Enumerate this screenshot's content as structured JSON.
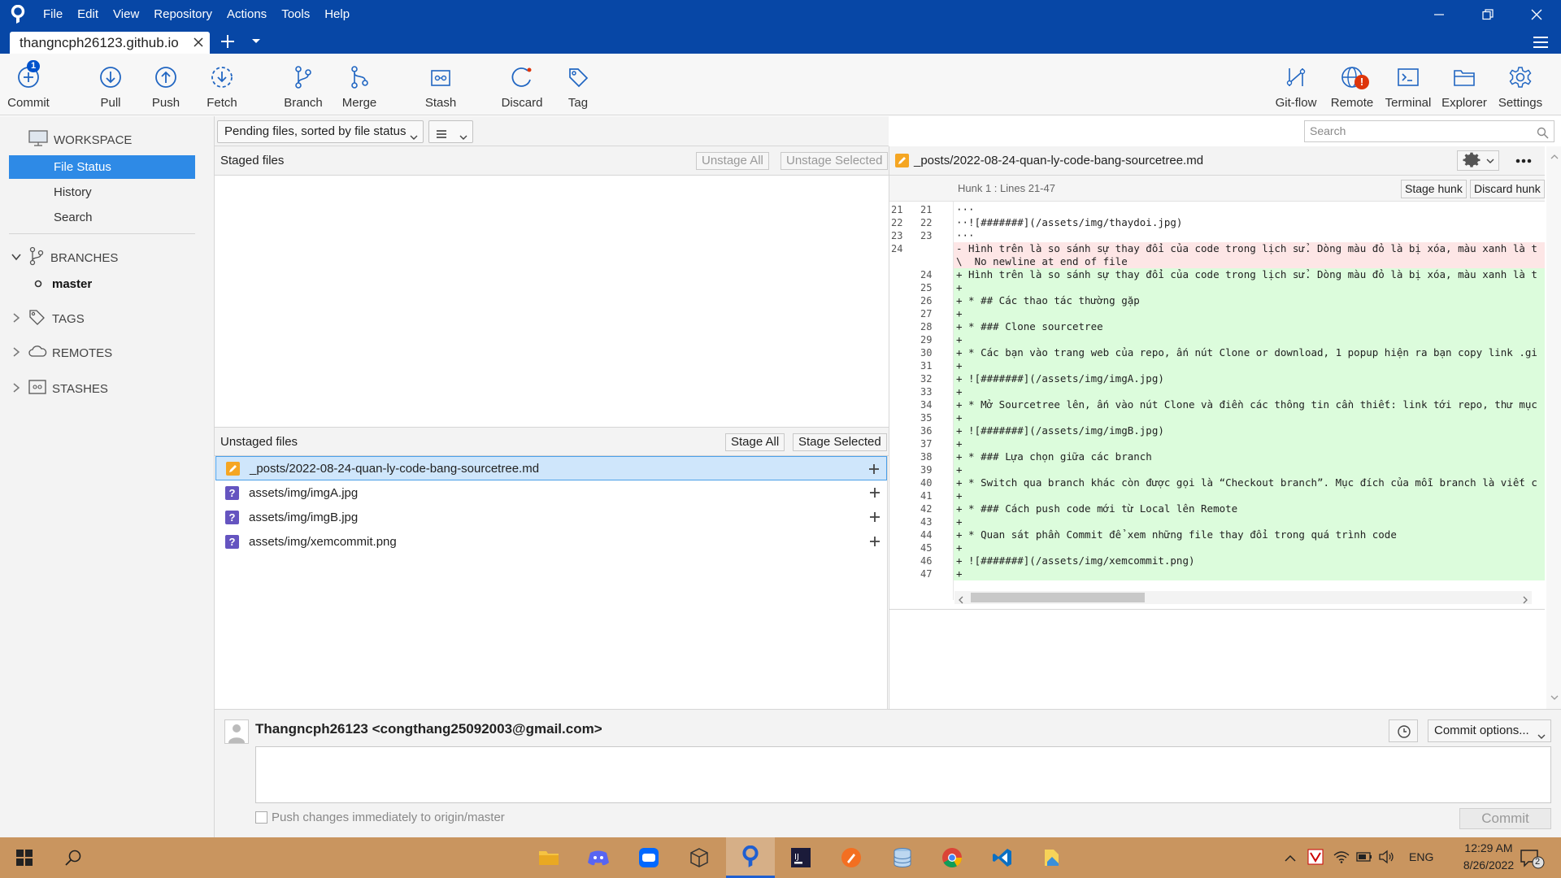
{
  "window": {
    "menu": [
      "File",
      "Edit",
      "View",
      "Repository",
      "Actions",
      "Tools",
      "Help"
    ],
    "repo_tab": "thangncph26123.github.io"
  },
  "toolbar": {
    "left": [
      {
        "label": "Commit",
        "icon": "commit-plus-icon",
        "badge": "1"
      },
      {
        "label": "Pull",
        "icon": "pull-arrow-down-icon"
      },
      {
        "label": "Push",
        "icon": "push-arrow-up-icon"
      },
      {
        "label": "Fetch",
        "icon": "fetch-dashed-arrow-icon"
      },
      {
        "label": "Branch",
        "icon": "branch-icon"
      },
      {
        "label": "Merge",
        "icon": "merge-icon"
      },
      {
        "label": "Stash",
        "icon": "stash-icon"
      },
      {
        "label": "Discard",
        "icon": "discard-icon"
      },
      {
        "label": "Tag",
        "icon": "tag-icon"
      }
    ],
    "right": [
      {
        "label": "Git-flow",
        "icon": "git-flow-icon"
      },
      {
        "label": "Remote",
        "icon": "globe-icon",
        "alert": "!"
      },
      {
        "label": "Terminal",
        "icon": "terminal-icon"
      },
      {
        "label": "Explorer",
        "icon": "folder-icon"
      },
      {
        "label": "Settings",
        "icon": "gear-icon"
      }
    ]
  },
  "sidebar": {
    "workspace": "WORKSPACE",
    "items": [
      "File Status",
      "History",
      "Search"
    ],
    "branches": "BRANCHES",
    "current_branch": "master",
    "tags": "TAGS",
    "remotes": "REMOTES",
    "stashes": "STASHES"
  },
  "filter": {
    "sort_label": "Pending files, sorted by file status",
    "view_icon": "list-view-icon"
  },
  "staged": {
    "title": "Staged files",
    "unstage_all": "Unstage All",
    "unstage_selected": "Unstage Selected"
  },
  "unstaged": {
    "title": "Unstaged files",
    "stage_all": "Stage All",
    "stage_selected": "Stage Selected",
    "files": [
      {
        "name": "_posts/2022-08-24-quan-ly-code-bang-sourcetree.md",
        "status": "modified"
      },
      {
        "name": "assets/img/imgA.jpg",
        "status": "untracked"
      },
      {
        "name": "assets/img/imgB.jpg",
        "status": "untracked"
      },
      {
        "name": "assets/img/xemcommit.png",
        "status": "untracked"
      }
    ]
  },
  "search": {
    "placeholder": "Search"
  },
  "diff": {
    "file": "_posts/2022-08-24-quan-ly-code-bang-sourcetree.md",
    "hunk": "Hunk 1 : Lines 21-47",
    "stage_hunk": "Stage hunk",
    "discard_hunk": "Discard hunk",
    "lines": [
      {
        "old": "21",
        "new": "21",
        "type": "ctx",
        "text": "···"
      },
      {
        "old": "22",
        "new": "22",
        "type": "ctx",
        "text": "··![#######](/assets/img/thaydoi.jpg)"
      },
      {
        "old": "23",
        "new": "23",
        "type": "ctx",
        "text": "···"
      },
      {
        "old": "24",
        "new": "",
        "type": "del",
        "text": "- Hình trên là so sánh sự thay đổi của code trong lịch sử. Dòng màu đỏ là bị xóa, màu xanh là t"
      },
      {
        "old": "",
        "new": "",
        "type": "del",
        "text": "\\  No newline at end of file"
      },
      {
        "old": "",
        "new": "24",
        "type": "add",
        "text": "+ Hình trên là so sánh sự thay đổi của code trong lịch sử. Dòng màu đỏ là bị xóa, màu xanh là t"
      },
      {
        "old": "",
        "new": "25",
        "type": "add",
        "text": "+"
      },
      {
        "old": "",
        "new": "26",
        "type": "add",
        "text": "+ * ## Các thao tác thường gặp"
      },
      {
        "old": "",
        "new": "27",
        "type": "add",
        "text": "+"
      },
      {
        "old": "",
        "new": "28",
        "type": "add",
        "text": "+ * ### Clone sourcetree"
      },
      {
        "old": "",
        "new": "29",
        "type": "add",
        "text": "+"
      },
      {
        "old": "",
        "new": "30",
        "type": "add",
        "text": "+ * Các bạn vào trang web của repo, ấn nút Clone or download, 1 popup hiện ra bạn copy link .gi"
      },
      {
        "old": "",
        "new": "31",
        "type": "add",
        "text": "+"
      },
      {
        "old": "",
        "new": "32",
        "type": "add",
        "text": "+ ![#######](/assets/img/imgA.jpg)"
      },
      {
        "old": "",
        "new": "33",
        "type": "add",
        "text": "+"
      },
      {
        "old": "",
        "new": "34",
        "type": "add",
        "text": "+ * Mở Sourcetree lên, ấn vào nút Clone và điền các thông tin cần thiết: link tới repo, thư mục"
      },
      {
        "old": "",
        "new": "35",
        "type": "add",
        "text": "+"
      },
      {
        "old": "",
        "new": "36",
        "type": "add",
        "text": "+ ![#######](/assets/img/imgB.jpg)"
      },
      {
        "old": "",
        "new": "37",
        "type": "add",
        "text": "+"
      },
      {
        "old": "",
        "new": "38",
        "type": "add",
        "text": "+ * ### Lựa chọn giữa các branch"
      },
      {
        "old": "",
        "new": "39",
        "type": "add",
        "text": "+"
      },
      {
        "old": "",
        "new": "40",
        "type": "add",
        "text": "+ * Switch qua branch khác còn được gọi là “Checkout branch”. Mục đích của mỗi branch là viết c"
      },
      {
        "old": "",
        "new": "41",
        "type": "add",
        "text": "+"
      },
      {
        "old": "",
        "new": "42",
        "type": "add",
        "text": "+ * ### Cách push code mới từ Local lên Remote"
      },
      {
        "old": "",
        "new": "43",
        "type": "add",
        "text": "+"
      },
      {
        "old": "",
        "new": "44",
        "type": "add",
        "text": "+ * Quan sát phần Commit để xem những file thay đổi trong quá trình code"
      },
      {
        "old": "",
        "new": "45",
        "type": "add",
        "text": "+"
      },
      {
        "old": "",
        "new": "46",
        "type": "add",
        "text": "+ ![#######](/assets/img/xemcommit.png)"
      },
      {
        "old": "",
        "new": "47",
        "type": "add",
        "text": "+"
      }
    ]
  },
  "commit": {
    "author": "Thangncph26123 <congthang25092003@gmail.com>",
    "options": "Commit options...",
    "push_label": "Push changes immediately to origin/master",
    "commit_button": "Commit"
  },
  "taskbar": {
    "apps": [
      "file-explorer-icon",
      "discord-icon",
      "zalo-icon",
      "cube-icon",
      "sourcetree-icon",
      "jetbrains-icon",
      "pen-app-icon",
      "database-icon",
      "chrome-icon",
      "vscode-icon",
      "file-manager-icon"
    ],
    "lang": "ENG",
    "time": "12:29 AM",
    "date": "8/26/2022",
    "notifications": "2"
  }
}
